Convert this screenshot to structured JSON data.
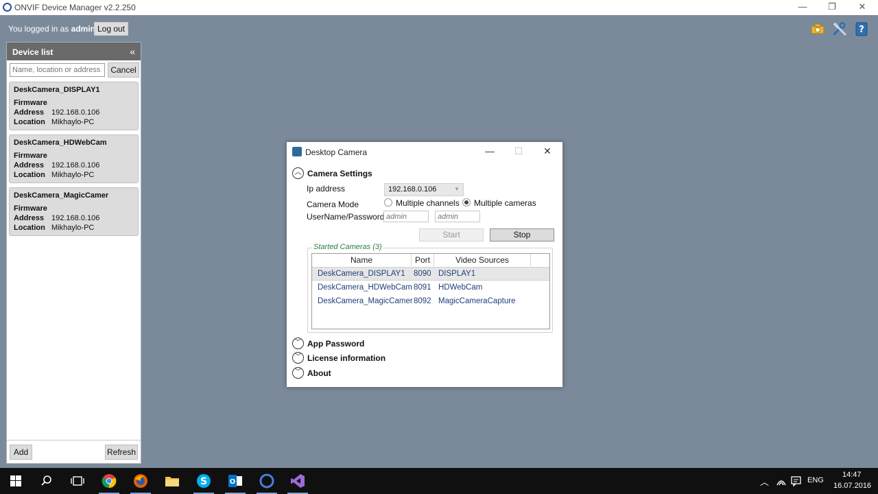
{
  "window": {
    "title": "ONVIF Device Manager v2.2.250"
  },
  "login": {
    "prefix": "You logged in as",
    "user": "admin",
    "logout_label": "Log out"
  },
  "device_list": {
    "title": "Device list",
    "search_placeholder": "Name, location or address",
    "cancel_label": "Cancel",
    "devices": [
      {
        "name": "DeskCamera_DISPLAY1",
        "firmware_label": "Firmware",
        "address_label": "Address",
        "address": "192.168.0.106",
        "location_label": "Location",
        "location": "Mikhaylo-PC"
      },
      {
        "name": "DeskCamera_HDWebCam",
        "firmware_label": "Firmware",
        "address_label": "Address",
        "address": "192.168.0.106",
        "location_label": "Location",
        "location": "Mikhaylo-PC"
      },
      {
        "name": "DeskCamera_MagicCamer",
        "firmware_label": "Firmware",
        "address_label": "Address",
        "address": "192.168.0.106",
        "location_label": "Location",
        "location": "Mikhaylo-PC"
      }
    ],
    "add_label": "Add",
    "refresh_label": "Refresh"
  },
  "dialog": {
    "title": "Desktop Camera",
    "camera_settings": "Camera Settings",
    "ip_label": "Ip address",
    "ip_value": "192.168.0.106",
    "mode_label": "Camera Mode",
    "mode_option_1": "Multiple channels",
    "mode_option_2": "Multiple cameras",
    "selected_mode": "Multiple cameras",
    "credentials_label": "UserName/Password",
    "username_placeholder": "admin",
    "password_placeholder": "admin",
    "start_label": "Start",
    "stop_label": "Stop",
    "started_cameras": "Started Cameras (3)",
    "columns": [
      "Name",
      "Port",
      "Video Sources"
    ],
    "rows": [
      {
        "name": "DeskCamera_DISPLAY1",
        "port": "8090",
        "source": "DISPLAY1"
      },
      {
        "name": "DeskCamera_HDWebCam",
        "port": "8091",
        "source": "HDWebCam"
      },
      {
        "name": "DeskCamera_MagicCamer",
        "port": "8092",
        "source": "MagicCameraCapture"
      }
    ],
    "app_password": "App Password",
    "license_information": "License information",
    "about": "About"
  },
  "taskbar": {
    "language": "ENG",
    "time": "14:47",
    "date": "16.07.2016"
  },
  "colors": {
    "desktop": "#7b8a9b",
    "panel_header": "#6a6a6a",
    "legend_green": "#2a7d3b",
    "taskbar": "#101010"
  }
}
